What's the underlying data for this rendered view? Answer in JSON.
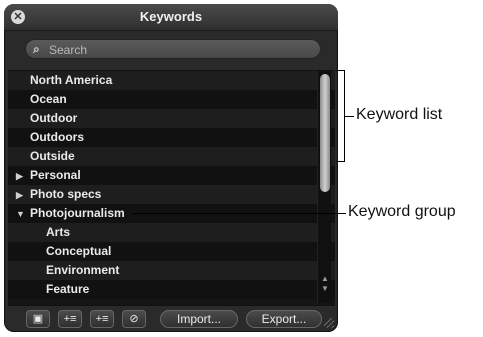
{
  "window": {
    "title": "Keywords"
  },
  "search": {
    "placeholder": "Search"
  },
  "keywords": {
    "items": [
      {
        "label": "North America",
        "type": "item"
      },
      {
        "label": "Ocean",
        "type": "item"
      },
      {
        "label": "Outdoor",
        "type": "item"
      },
      {
        "label": "Outdoors",
        "type": "item"
      },
      {
        "label": "Outside",
        "type": "item"
      },
      {
        "label": "Personal",
        "type": "group",
        "expanded": false
      },
      {
        "label": "Photo specs",
        "type": "group",
        "expanded": false
      },
      {
        "label": "Photojournalism",
        "type": "group",
        "expanded": true
      },
      {
        "label": "Arts",
        "type": "child"
      },
      {
        "label": "Conceptual",
        "type": "child"
      },
      {
        "label": "Environment",
        "type": "child"
      },
      {
        "label": "Feature",
        "type": "child"
      }
    ]
  },
  "toolbar": {
    "lock_icon": "lock-icon",
    "add_keyword_icon": "add-keyword-icon",
    "add_child_icon": "add-child-icon",
    "remove_icon": "remove-icon",
    "import_label": "Import...",
    "export_label": "Export..."
  },
  "callouts": {
    "keyword_list": "Keyword list",
    "keyword_group": "Keyword group"
  },
  "colors": {
    "panel_bg": "#2a2a2a",
    "list_bg": "#151515",
    "text": "#eaeaea"
  }
}
